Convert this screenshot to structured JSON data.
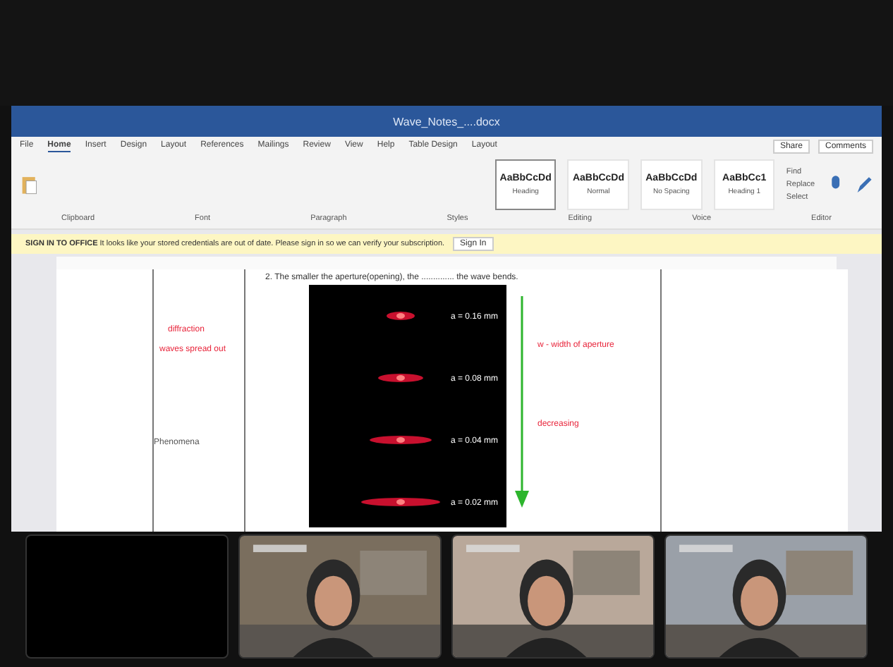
{
  "window": {
    "title": "Wave_Notes_....docx"
  },
  "ribbon_tabs": [
    {
      "label": "File",
      "selected": false
    },
    {
      "label": "Home",
      "selected": true
    },
    {
      "label": "Insert",
      "selected": false
    },
    {
      "label": "Design",
      "selected": false
    },
    {
      "label": "Layout",
      "selected": false
    },
    {
      "label": "References",
      "selected": false
    },
    {
      "label": "Mailings",
      "selected": false
    },
    {
      "label": "Review",
      "selected": false
    },
    {
      "label": "View",
      "selected": false
    },
    {
      "label": "Help",
      "selected": false
    },
    {
      "label": "Table Design",
      "selected": false
    },
    {
      "label": "Layout",
      "selected": false
    }
  ],
  "share": "Share",
  "comments": "Comments",
  "styles": [
    {
      "sample": "AaBbCcDd",
      "name": "Heading",
      "selected": true
    },
    {
      "sample": "AaBbCcDd",
      "name": "Normal",
      "selected": false
    },
    {
      "sample": "AaBbCcDd",
      "name": "No Spacing",
      "selected": false
    },
    {
      "sample": "AaBbCc1",
      "name": "Heading 1",
      "selected": false
    }
  ],
  "editing": [
    "Find",
    "Replace",
    "Select"
  ],
  "groups": [
    "Clipboard",
    "Font",
    "Paragraph",
    "Styles",
    "Editing",
    "Voice",
    "Editor"
  ],
  "notice": {
    "title": "SIGN IN TO OFFICE",
    "text": "It looks like your stored credentials are out of date. Please sign in so we can verify your subscription.",
    "button": "Sign In"
  },
  "document": {
    "question": "2. The smaller the aperture(opening), the .............. the wave bends.",
    "annotations": {
      "label_1": "diffraction",
      "label_2": "waves spread out",
      "label_3": "w - width of aperture",
      "label_4": "decreasing"
    },
    "row_label": "Phenomena",
    "image_labels": [
      "a = 0.16 mm",
      "a = 0.08 mm",
      "a = 0.04 mm",
      "a = 0.02 mm"
    ]
  },
  "participants": [
    {
      "kind": "off"
    },
    {
      "kind": "picture"
    },
    {
      "kind": "picture"
    },
    {
      "kind": "picture"
    }
  ]
}
